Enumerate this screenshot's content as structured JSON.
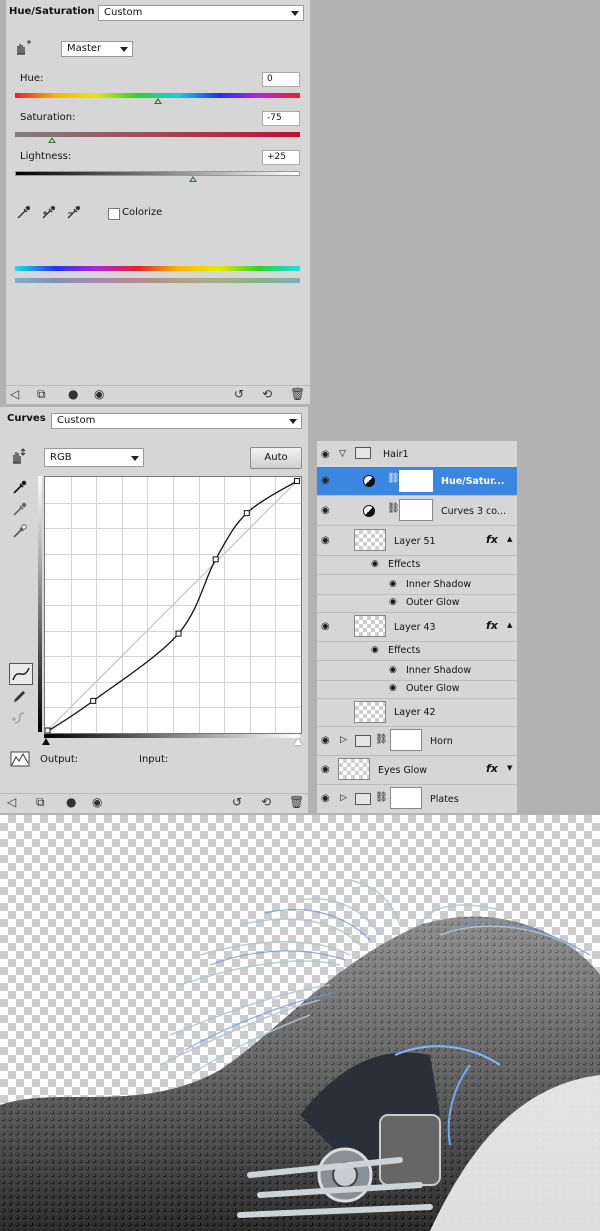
{
  "hue_sat": {
    "title": "Hue/Saturation",
    "preset": "Custom",
    "channel": "Master",
    "hue": {
      "label": "Hue:",
      "value": "0"
    },
    "saturation": {
      "label": "Saturation:",
      "value": "-75"
    },
    "lightness": {
      "label": "Lightness:",
      "value": "+25"
    },
    "colorize_label": "Colorize",
    "colorize_checked": false
  },
  "curves": {
    "title": "Curves",
    "preset": "Custom",
    "channel": "RGB",
    "auto_label": "Auto",
    "output_label": "Output:",
    "input_label": "Input:",
    "points": [
      [
        0,
        0
      ],
      [
        48,
        32
      ],
      [
        133,
        99
      ],
      [
        170,
        173
      ],
      [
        201,
        219
      ],
      [
        251,
        251
      ]
    ]
  },
  "layers": {
    "rows": [
      {
        "name": "Hair1",
        "type": "group-open",
        "visible": true
      },
      {
        "name": "Hue/Satur...",
        "type": "adjustment",
        "visible": true,
        "selected": true
      },
      {
        "name": "Curves 3 co...",
        "type": "adjustment",
        "visible": true
      },
      {
        "name": "Layer 51",
        "type": "layer-fx",
        "visible": true,
        "fx": "fx"
      },
      {
        "name": "Effects",
        "type": "effects"
      },
      {
        "name": "Inner Shadow",
        "type": "effect"
      },
      {
        "name": "Outer Glow",
        "type": "effect"
      },
      {
        "name": "Layer 43",
        "type": "layer-fx",
        "visible": true,
        "fx": "fx"
      },
      {
        "name": "Effects",
        "type": "effects"
      },
      {
        "name": "Inner Shadow",
        "type": "effect"
      },
      {
        "name": "Outer Glow",
        "type": "effect"
      },
      {
        "name": "Layer 42",
        "type": "layer",
        "visible": false
      },
      {
        "name": "Horn",
        "type": "group-closed",
        "visible": true
      },
      {
        "name": "Eyes Glow",
        "type": "layer-fx-top",
        "visible": true,
        "fx": "fx"
      },
      {
        "name": "Plates",
        "type": "group-closed",
        "visible": true
      }
    ]
  },
  "colors": {
    "panel": "#d6d6d6",
    "selected_row": "#3b86e0",
    "background": "#b2b2b2"
  }
}
